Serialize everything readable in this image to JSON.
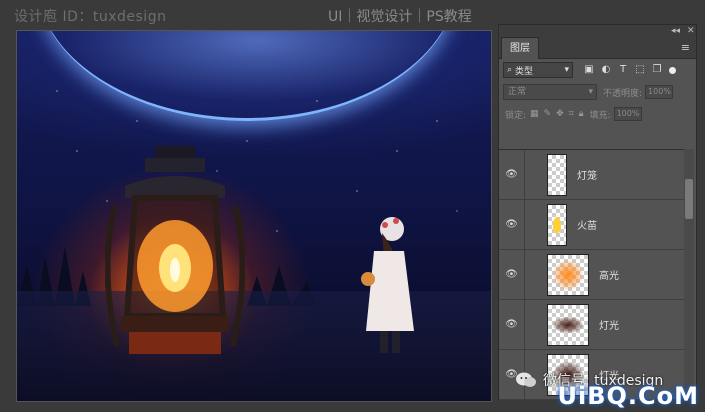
{
  "watermark_top": "设计庖 ID：tuxdesign",
  "top_title": "UI｜视觉设计｜PS教程",
  "panel": {
    "tab_label": "图层",
    "collapse_glyph": "◂◂",
    "close_glyph": "✕",
    "menu_glyph": "≡",
    "filter_kind": "类型",
    "blend_mode": "正常",
    "opacity_label": "不透明度:",
    "opacity_value": "100%",
    "lock_label": "锁定:",
    "fill_label": "填充:",
    "fill_value": "100%",
    "layers": [
      {
        "name": "灯笼",
        "visible": true,
        "thumb": "lantern-outline"
      },
      {
        "name": "火苗",
        "visible": true,
        "thumb": "flame"
      },
      {
        "name": "高光",
        "visible": true,
        "thumb": "orange-glow"
      },
      {
        "name": "灯光",
        "visible": true,
        "thumb": "dark-glow"
      },
      {
        "name": "灯光",
        "visible": true,
        "thumb": "dark-glow-2"
      }
    ]
  },
  "wechat_label": "微信号: tuxdesign",
  "site_mark": "UiBQ.CoM",
  "colors": {
    "panel_bg": "#535353",
    "app_bg": "#3a3a3a",
    "glow_orange": "#ff9a2e"
  }
}
